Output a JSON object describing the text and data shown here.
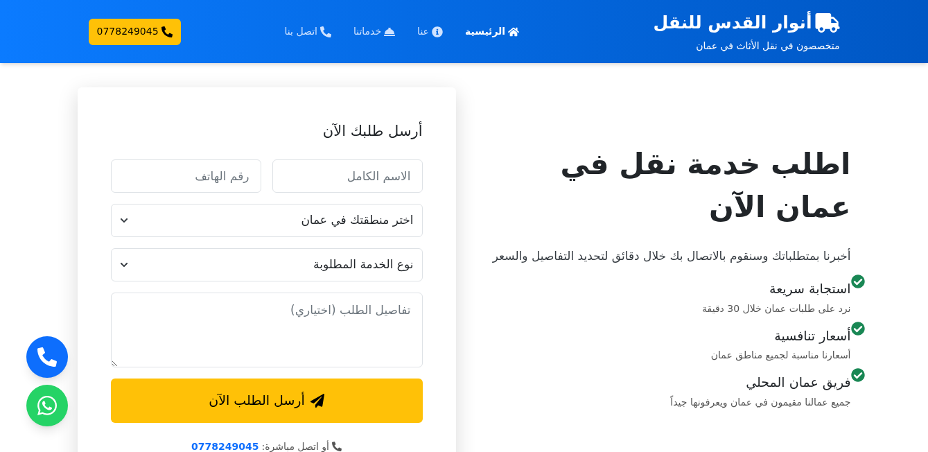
{
  "header": {
    "brand": {
      "title": "أنوار القدس للنقل",
      "subtitle": "متخصصون في نقل الأثاث في عمان"
    },
    "nav": [
      {
        "label": "الرئيسية",
        "selected": true
      },
      {
        "label": "عنا",
        "selected": false
      },
      {
        "label": "خدماتنا",
        "selected": false
      },
      {
        "label": "اتصل بنا",
        "selected": false
      }
    ],
    "phone_button": {
      "label": "0778249045"
    }
  },
  "hero": {
    "title": "اطلب خدمة نقل في عمان الآن",
    "description": "أخبرنا بمتطلباتك وسنقوم بالاتصال بك خلال دقائق لتحديد التفاصيل والسعر",
    "features": [
      {
        "title": "استجابة سريعة",
        "description": "نرد على طلبات عمان خلال 30 دقيقة"
      },
      {
        "title": "أسعار تنافسية",
        "description": "أسعارنا مناسبة لجميع مناطق عمان"
      },
      {
        "title": "فريق عمان المحلي",
        "description": "جميع عمالنا مقيمون في عمان ويعرفونها جيداً"
      }
    ]
  },
  "form": {
    "title": "أرسل طلبك الآن",
    "name": {
      "placeholder": "الاسم الكامل"
    },
    "phone": {
      "placeholder": "رقم الهاتف"
    },
    "region": {
      "value": "اختر منطقتك في عمان"
    },
    "service": {
      "value": "نوع الخدمة المطلوبة"
    },
    "details": {
      "placeholder": "تفاصيل الطلب (اختياري)"
    },
    "submit": "أرسل الطلب الآن",
    "contact": {
      "prefix": "أو اتصل مباشرة:",
      "number": "0778249045"
    }
  }
}
